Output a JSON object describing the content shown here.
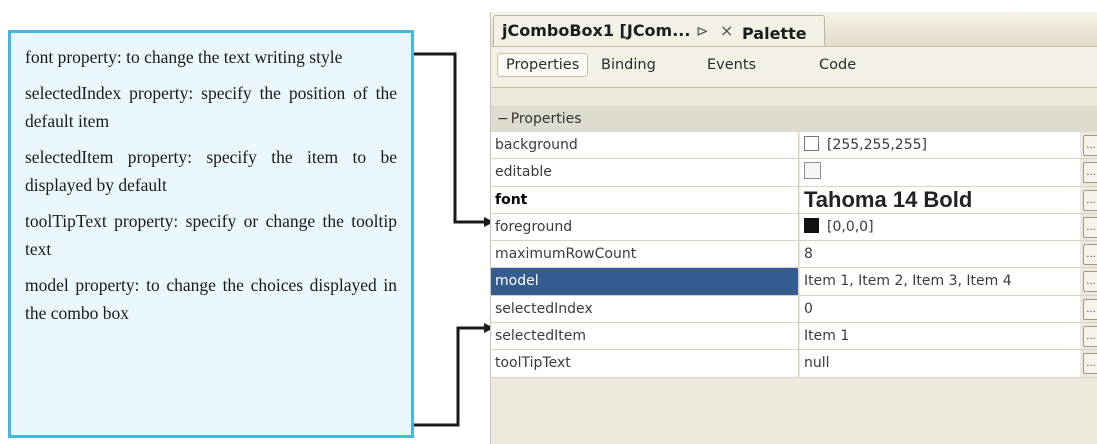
{
  "notes": [
    "font property: to change the text writing style",
    "selectedIndex property: specify the position of the default item",
    "selectedItem property: specify the item to be displayed by default",
    "toolTipText property: specify or change the tooltip text",
    "model property: to change the choices displayed in the combo box"
  ],
  "window": {
    "tab_title": "jComboBox1 [JCom...",
    "pin_glyph": "⊳",
    "close_glyph": "×",
    "second_tab": "Palette"
  },
  "tabs": [
    "Properties",
    "Binding",
    "Events",
    "Code"
  ],
  "active_tab": "Properties",
  "group_header": "Properties",
  "group_toggle": "−",
  "ellipsis": "...",
  "properties": [
    {
      "name": "background",
      "value": "[255,255,255]",
      "swatch": "white"
    },
    {
      "name": "editable",
      "value": "",
      "checkbox": true
    },
    {
      "name": "font",
      "value": "Tahoma 14 Bold",
      "bold": true
    },
    {
      "name": "foreground",
      "value": "[0,0,0]",
      "swatch": "black"
    },
    {
      "name": "maximumRowCount",
      "value": "8"
    },
    {
      "name": "model",
      "value": "Item 1, Item 2, Item 3, Item 4",
      "selected": true
    },
    {
      "name": "selectedIndex",
      "value": "0"
    },
    {
      "name": "selectedItem",
      "value": "Item 1"
    },
    {
      "name": "toolTipText",
      "value": "null"
    }
  ],
  "colors": {
    "note_border": "#45b7e3",
    "note_bg": "#eaf7fd",
    "selected_row": "#355c8e"
  }
}
